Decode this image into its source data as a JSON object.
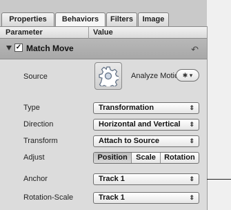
{
  "tabs": [
    {
      "label": "Properties",
      "active": false
    },
    {
      "label": "Behaviors",
      "active": true
    },
    {
      "label": "Filters",
      "active": false
    },
    {
      "label": "Image",
      "active": false
    }
  ],
  "header": {
    "parameter": "Parameter",
    "value": "Value"
  },
  "group": {
    "title": "Match Move",
    "checked": true,
    "reset_glyph": "↶"
  },
  "rows": {
    "source": {
      "label": "Source",
      "analyze_label": "Analyze Motion",
      "action_glyph": "✱ ▾"
    },
    "type": {
      "label": "Type",
      "value": "Transformation"
    },
    "direction": {
      "label": "Direction",
      "value": "Horizontal and Vertical"
    },
    "transform": {
      "label": "Transform",
      "value": "Attach to Source"
    },
    "adjust": {
      "label": "Adjust",
      "options": [
        "Position",
        "Scale",
        "Rotation"
      ],
      "selected": "Position"
    },
    "anchor": {
      "label": "Anchor",
      "value": "Track 1"
    },
    "rotation_scale": {
      "label": "Rotation-Scale",
      "value": "Track 1"
    }
  },
  "popup_arrow": "⇕"
}
